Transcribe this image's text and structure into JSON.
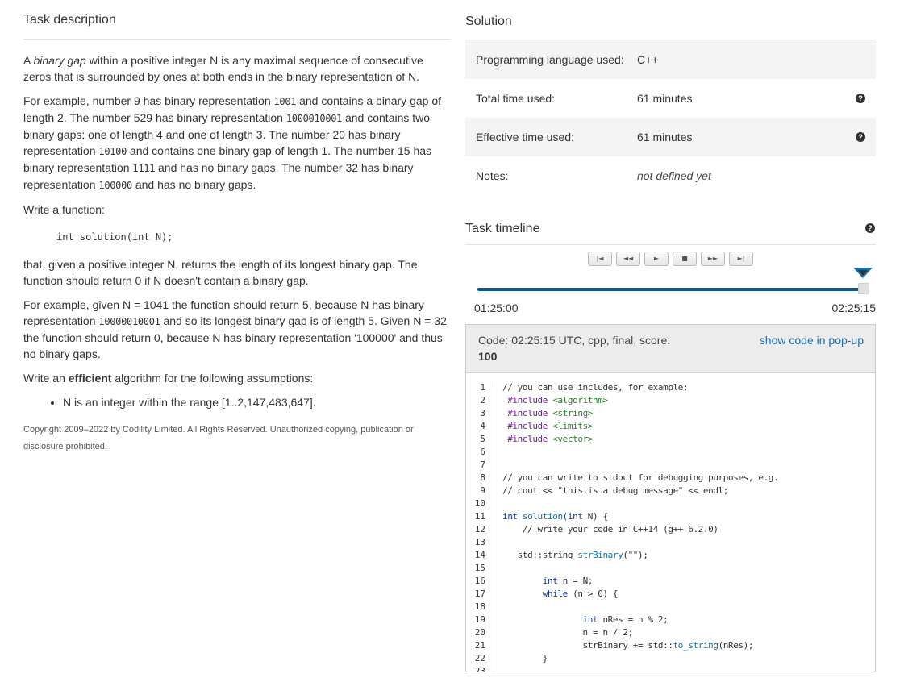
{
  "task": {
    "heading": "Task description",
    "p1_a": "A ",
    "p1_em": "binary gap",
    "p1_b": " within a positive integer N is any maximal sequence of consecutive zeros that is surrounded by ones at both ends in the binary representation of N.",
    "p2_a": "For example, number 9 has binary representation ",
    "p2_m1": "1001",
    "p2_b": " and contains a binary gap of length 2. The number 529 has binary representation ",
    "p2_m2": "1000010001",
    "p2_c": " and contains two binary gaps: one of length 4 and one of length 3. The number 20 has binary representation ",
    "p2_m3": "10100",
    "p2_d": " and contains one binary gap of length 1. The number 15 has binary representation ",
    "p2_m4": "1111",
    "p2_e": " and has no binary gaps. The number 32 has binary representation ",
    "p2_m5": "100000",
    "p2_f": " and has no binary gaps.",
    "p3": "Write a function:",
    "signature": "int solution(int N);",
    "p4": "that, given a positive integer N, returns the length of its longest binary gap. The function should return 0 if N doesn't contain a binary gap.",
    "p5_a": "For example, given N = 1041 the function should return 5, because N has binary representation ",
    "p5_m": "10000010001",
    "p5_b": " and so its longest binary gap is of length 5. Given N = 32 the function should return 0, because N has binary representation '100000' and thus no binary gaps.",
    "p6_a": "Write an ",
    "p6_strong": "efficient",
    "p6_b": " algorithm for the following assumptions:",
    "assumption": "N is an integer within the range [1..2,147,483,647].",
    "copyright": "Copyright 2009–2022 by Codility Limited. All Rights Reserved. Unauthorized copying, publication or disclosure prohibited."
  },
  "solution": {
    "heading": "Solution",
    "rows": [
      {
        "key": "Programming language used:",
        "value": "C++"
      },
      {
        "key": "Total time used:",
        "value": "61 minutes"
      },
      {
        "key": "Effective time used:",
        "value": "61 minutes"
      },
      {
        "key": "Notes:",
        "value": "not defined yet"
      }
    ],
    "help_glyph": "?"
  },
  "timeline": {
    "heading": "Task timeline",
    "controls": [
      "|◄",
      "◄◄",
      "►",
      "■",
      "►►",
      "►|"
    ],
    "start_time": "01:25:00",
    "end_time": "02:25:15",
    "position": 1.0
  },
  "code": {
    "header": "Code: 02:25:15 UTC, cpp, final, score:",
    "score": "100",
    "popup_link": "show code in pop-up",
    "line_numbers": [
      "1",
      "2",
      "3",
      "4",
      "5",
      "6",
      "7",
      "8",
      "9",
      "10",
      "11",
      "12",
      "13",
      "14",
      "15",
      "16",
      "17",
      "18",
      "19",
      "20",
      "21",
      "22",
      "23"
    ],
    "l1": "// you can use includes, for example:",
    "l2_pp": " #include ",
    "l2_inc": "<algorithm>",
    "l3_pp": " #include ",
    "l3_inc": "<string>",
    "l4_pp": " #include ",
    "l4_inc": "<limits>",
    "l5_pp": " #include ",
    "l5_inc": "<vector>",
    "l8": "// you can write to stdout for debugging purposes, e.g.",
    "l9": "// cout << \"this is a debug message\" << endl;",
    "l11_kw": "int ",
    "l11_fn": "solution",
    "l11_kw2": "(int",
    "l11_rest": " N) {",
    "l12": "    // write your code in C++14 (g++ 6.2.0)",
    "l14_a": "   std::string ",
    "l14_fn": "strBinary",
    "l14_b": "(\"\");",
    "l16_kw": "        int",
    "l16_rest": " n = N;",
    "l17_kw": "        while",
    "l17_rest": " (n > 0) {",
    "l19_kw": "                int",
    "l19_rest": " nRes = n % 2;",
    "l20": "                n = n / 2;",
    "l21_a": "                strBinary += std::",
    "l21_fn": "to_string",
    "l21_b": "(nRes);",
    "l22": "        }",
    "l23": ""
  }
}
